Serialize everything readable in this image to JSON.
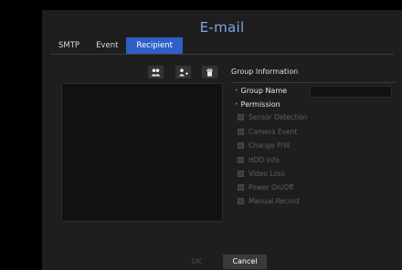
{
  "dialog": {
    "title": "E-mail"
  },
  "tabs": [
    {
      "label": "SMTP",
      "active": false
    },
    {
      "label": "Event",
      "active": false
    },
    {
      "label": "Recipient",
      "active": true
    }
  ],
  "toolbar": {
    "icons": [
      "group-users-icon",
      "add-user-icon",
      "delete-icon"
    ]
  },
  "group_info": {
    "title": "Group Information",
    "group_name_label": "Group Name",
    "group_name_value": "",
    "permission_label": "Permission",
    "permissions": [
      "Sensor Detection",
      "Camera Event",
      "Change P/W",
      "HDD Info",
      "Video Loss",
      "Power On/Off",
      "Manual Record"
    ]
  },
  "buttons": {
    "ok": "OK",
    "cancel": "Cancel"
  },
  "colors": {
    "accent": "#2d5fc7",
    "title": "#7fa3e6",
    "disabled_text": "#5e5e5e"
  }
}
